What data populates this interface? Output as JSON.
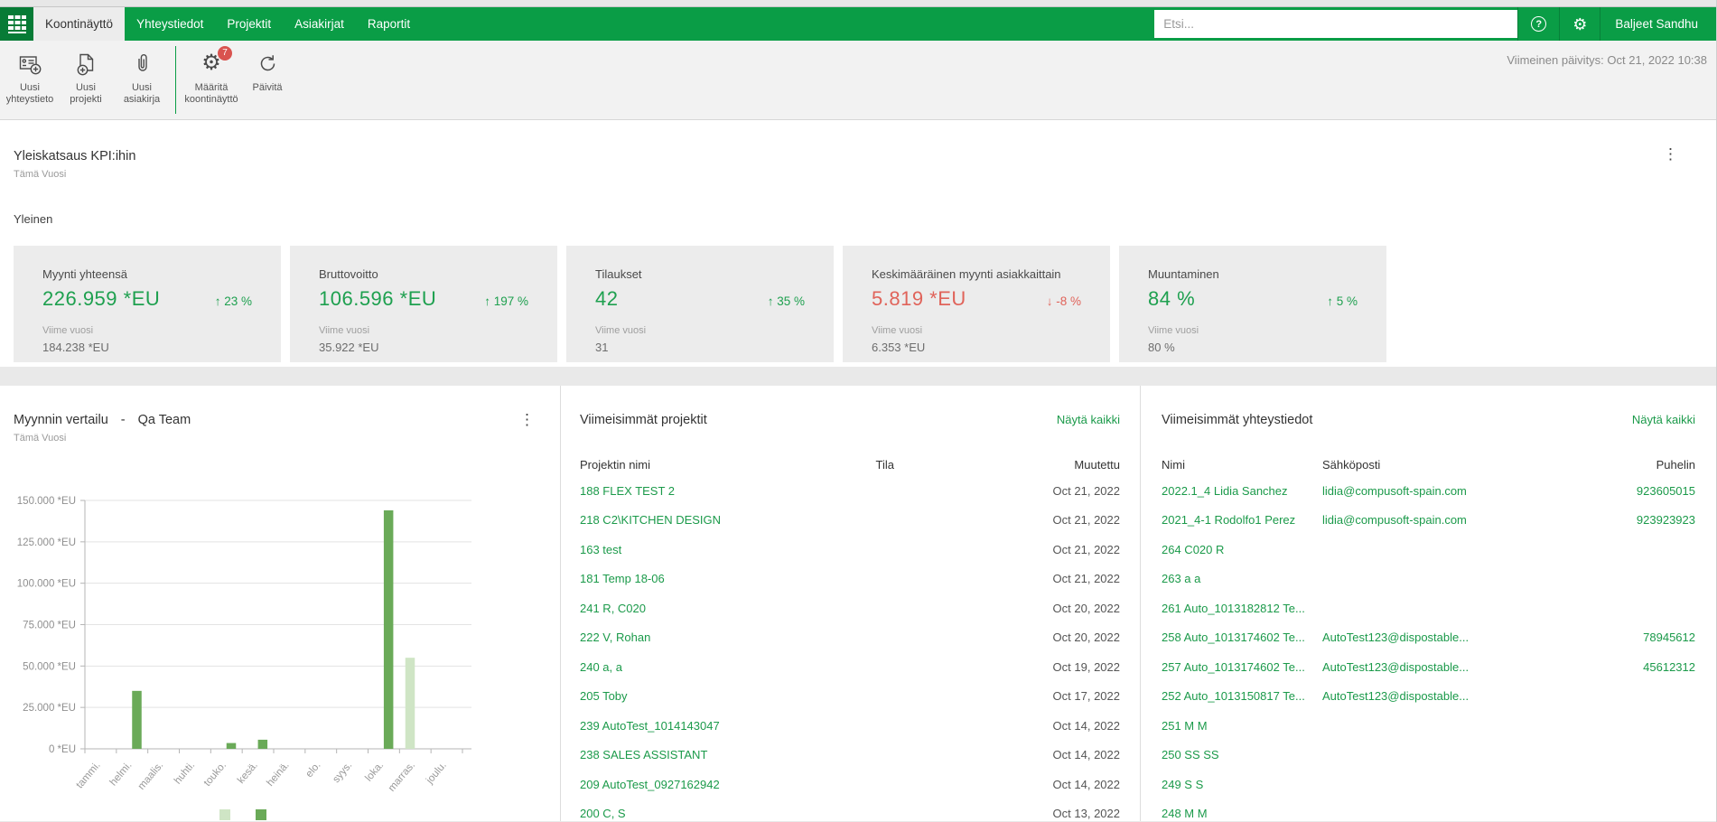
{
  "nav": {
    "tabs": [
      {
        "label": "Koontinäyttö",
        "state": "active"
      },
      {
        "label": "Yhteystiedot",
        "state": ""
      },
      {
        "label": "Projektit",
        "state": ""
      },
      {
        "label": "Asiakirjat",
        "state": ""
      },
      {
        "label": "Raportit",
        "state": ""
      }
    ],
    "search_placeholder": "Etsi...",
    "help_glyph": "?",
    "gear_glyph": "⚙",
    "user_name": "Baljeet Sandhu"
  },
  "toolbar": {
    "buttons": [
      {
        "line1": "Uusi",
        "line2": "yhteystieto"
      },
      {
        "line1": "Uusi",
        "line2": "projekti"
      },
      {
        "line1": "Uusi",
        "line2": "asiakirja"
      },
      {
        "line1": "Määritä",
        "line2": "koontinäyttö",
        "badge": "7"
      },
      {
        "line1": "Päivitä",
        "line2": ""
      }
    ],
    "last_update": "Viimeinen päivitys: Oct 21, 2022 10:38"
  },
  "kpi": {
    "title": "Yleiskatsaus KPI:ihin",
    "subtitle": "Tämä Vuosi",
    "group_label": "Yleinen",
    "kebab_glyph": "⋮",
    "cards": [
      {
        "label": "Myynti yhteensä",
        "value": "226.959 *EU",
        "arrow": "↑",
        "delta": "23 %",
        "tone": "pos",
        "last_year_label": "Viime vuosi",
        "last_year": "184.238 *EU"
      },
      {
        "label": "Bruttovoitto",
        "value": "106.596 *EU",
        "arrow": "↑",
        "delta": "197 %",
        "tone": "pos",
        "last_year_label": "Viime vuosi",
        "last_year": "35.922 *EU"
      },
      {
        "label": "Tilaukset",
        "value": "42",
        "arrow": "↑",
        "delta": "35 %",
        "tone": "pos",
        "last_year_label": "Viime vuosi",
        "last_year": "31"
      },
      {
        "label": "Keskimääräinen myynti asiakkaittain",
        "value": "5.819 *EU",
        "arrow": "↓",
        "delta": "-8 %",
        "tone": "neg",
        "last_year_label": "Viime vuosi",
        "last_year": "6.353 *EU"
      },
      {
        "label": "Muuntaminen",
        "value": "84 %",
        "arrow": "↑",
        "delta": "5 %",
        "tone": "pos",
        "last_year_label": "Viime vuosi",
        "last_year": "80 %"
      }
    ]
  },
  "chart_panel": {
    "title": "Myynnin vertailu",
    "separator": "-",
    "team": "Qa Team",
    "subtitle": "Tämä Vuosi",
    "kebab_glyph": "⋮"
  },
  "chart_data": {
    "type": "bar",
    "title": "Myynnin vertailu - Qa Team",
    "subtitle": "Tämä Vuosi",
    "categories": [
      "tammi.",
      "helmi.",
      "maalis.",
      "huhti.",
      "touko.",
      "kesä.",
      "heinä.",
      "elo.",
      "syys.",
      "loka.",
      "marras.",
      "joulu."
    ],
    "series": [
      {
        "color": "#cfe5c5",
        "values": [
          0,
          0,
          0,
          0,
          0,
          0,
          0,
          0,
          0,
          0,
          55000,
          0
        ]
      },
      {
        "color": "#6aaa58",
        "values": [
          0,
          35000,
          0,
          0,
          3500,
          5500,
          0,
          0,
          0,
          144000,
          0,
          0
        ]
      }
    ],
    "ylim": [
      0,
      150000
    ],
    "ytick_labels": [
      "0 *EU",
      "25.000 *EU",
      "50.000 *EU",
      "75.000 *EU",
      "100.000 *EU",
      "125.000 *EU",
      "150.000 *EU"
    ],
    "grid": true,
    "legend_position": "bottom"
  },
  "projects": {
    "title": "Viimeisimmät projektit",
    "view_all": "Näytä kaikki",
    "columns": [
      "Projektin nimi",
      "Tila",
      "Muutettu"
    ],
    "rows": [
      {
        "name": "188 FLEX TEST 2",
        "status": "",
        "date": "Oct 21, 2022"
      },
      {
        "name": "218 C2\\KITCHEN DESIGN",
        "status": "",
        "date": "Oct 21, 2022"
      },
      {
        "name": "163 test",
        "status": "",
        "date": "Oct 21, 2022"
      },
      {
        "name": "181 Temp 18-06",
        "status": "",
        "date": "Oct 21, 2022"
      },
      {
        "name": "241 R, C020",
        "status": "",
        "date": "Oct 20, 2022"
      },
      {
        "name": "222 V, Rohan",
        "status": "",
        "date": "Oct 20, 2022"
      },
      {
        "name": "240 a, a",
        "status": "",
        "date": "Oct 19, 2022"
      },
      {
        "name": "205 Toby",
        "status": "",
        "date": "Oct 17, 2022"
      },
      {
        "name": "239 AutoTest_1014143047",
        "status": "",
        "date": "Oct 14, 2022"
      },
      {
        "name": "238 SALES ASSISTANT",
        "status": "",
        "date": "Oct 14, 2022"
      },
      {
        "name": "209 AutoTest_0927162942",
        "status": "",
        "date": "Oct 14, 2022"
      },
      {
        "name": "200 C, S",
        "status": "",
        "date": "Oct 13, 2022"
      }
    ]
  },
  "contacts": {
    "title": "Viimeisimmät yhteystiedot",
    "view_all": "Näytä kaikki",
    "columns": [
      "Nimi",
      "Sähköposti",
      "Puhelin"
    ],
    "rows": [
      {
        "name": "2022.1_4 Lidia Sanchez",
        "email": "lidia@compusoft-spain.com",
        "phone": "923605015"
      },
      {
        "name": "2021_4-1 Rodolfo1 Perez",
        "email": "lidia@compusoft-spain.com",
        "phone": "923923923"
      },
      {
        "name": "264 C020 R",
        "email": "",
        "phone": ""
      },
      {
        "name": "263 a a",
        "email": "",
        "phone": ""
      },
      {
        "name": "261 Auto_1013182812 Te...",
        "email": "",
        "phone": ""
      },
      {
        "name": "258 Auto_1013174602 Te...",
        "email": "AutoTest123@dispostable...",
        "phone": "78945612"
      },
      {
        "name": "257 Auto_1013174602 Te...",
        "email": "AutoTest123@dispostable...",
        "phone": "45612312"
      },
      {
        "name": "252 Auto_1013150817 Te...",
        "email": "AutoTest123@dispostable...",
        "phone": ""
      },
      {
        "name": "251 M M",
        "email": "",
        "phone": ""
      },
      {
        "name": "250 SS SS",
        "email": "",
        "phone": ""
      },
      {
        "name": "249 S S",
        "email": "",
        "phone": ""
      },
      {
        "name": "248 M M",
        "email": "",
        "phone": ""
      }
    ]
  },
  "colors": {
    "brand_green": "#0a9d46",
    "logo_green": "#077b36",
    "accent_green_link": "#1b9a4a",
    "kpi_positive": "#1ea04f",
    "kpi_negative": "#e0635a",
    "badge_red": "#d9534f",
    "bar_dark_green": "#6aaa58",
    "bar_light_green": "#cfe5c5",
    "card_bg": "#ececec"
  }
}
